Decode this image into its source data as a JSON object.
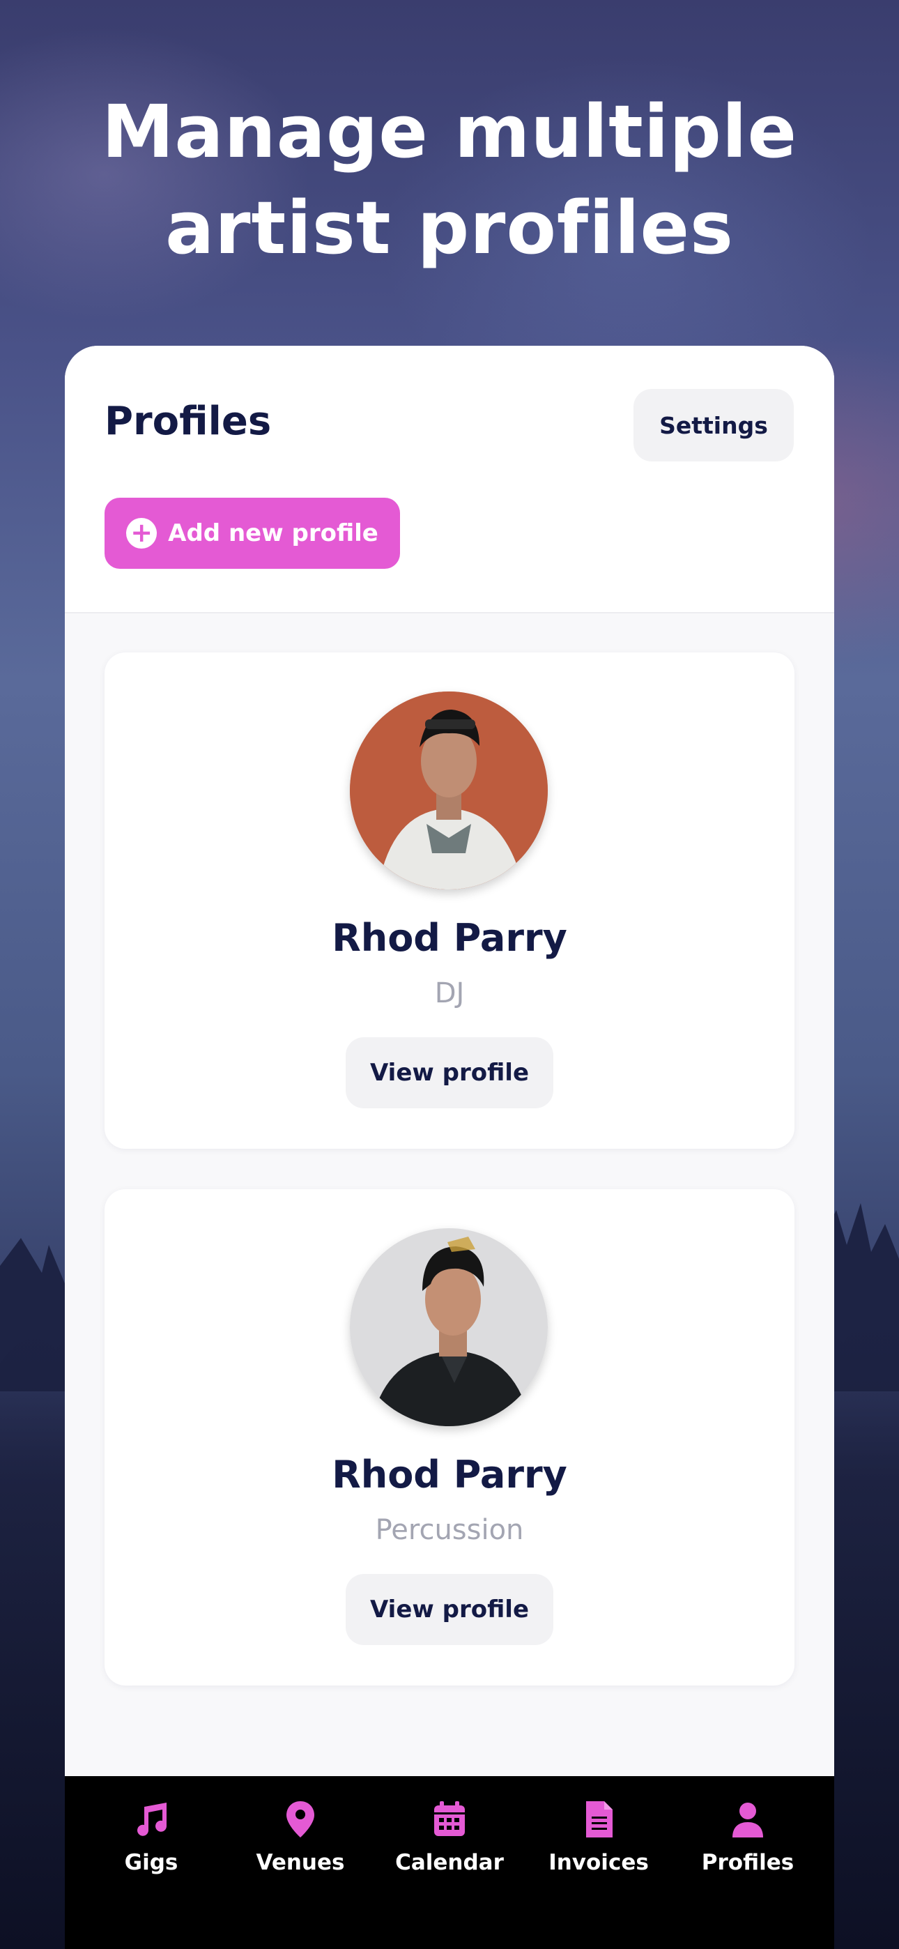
{
  "headline": {
    "line1": "Manage multiple",
    "line2": "artist profiles"
  },
  "panel": {
    "title": "Profiles",
    "settings_label": "Settings",
    "add_label": "Add new profile"
  },
  "profiles": [
    {
      "name": "Rhod Parry",
      "role": "DJ",
      "button_label": "View profile"
    },
    {
      "name": "Rhod Parry",
      "role": "Percussion",
      "button_label": "View profile"
    }
  ],
  "tabs": [
    {
      "label": "Gigs",
      "icon": "music-note-icon"
    },
    {
      "label": "Venues",
      "icon": "map-pin-icon"
    },
    {
      "label": "Calendar",
      "icon": "calendar-icon"
    },
    {
      "label": "Invoices",
      "icon": "document-icon"
    },
    {
      "label": "Profiles",
      "icon": "person-icon"
    }
  ],
  "colors": {
    "accent": "#e45ad4",
    "navy": "#131a45",
    "tabbar": "#000000",
    "muted": "#a3a5b2"
  }
}
